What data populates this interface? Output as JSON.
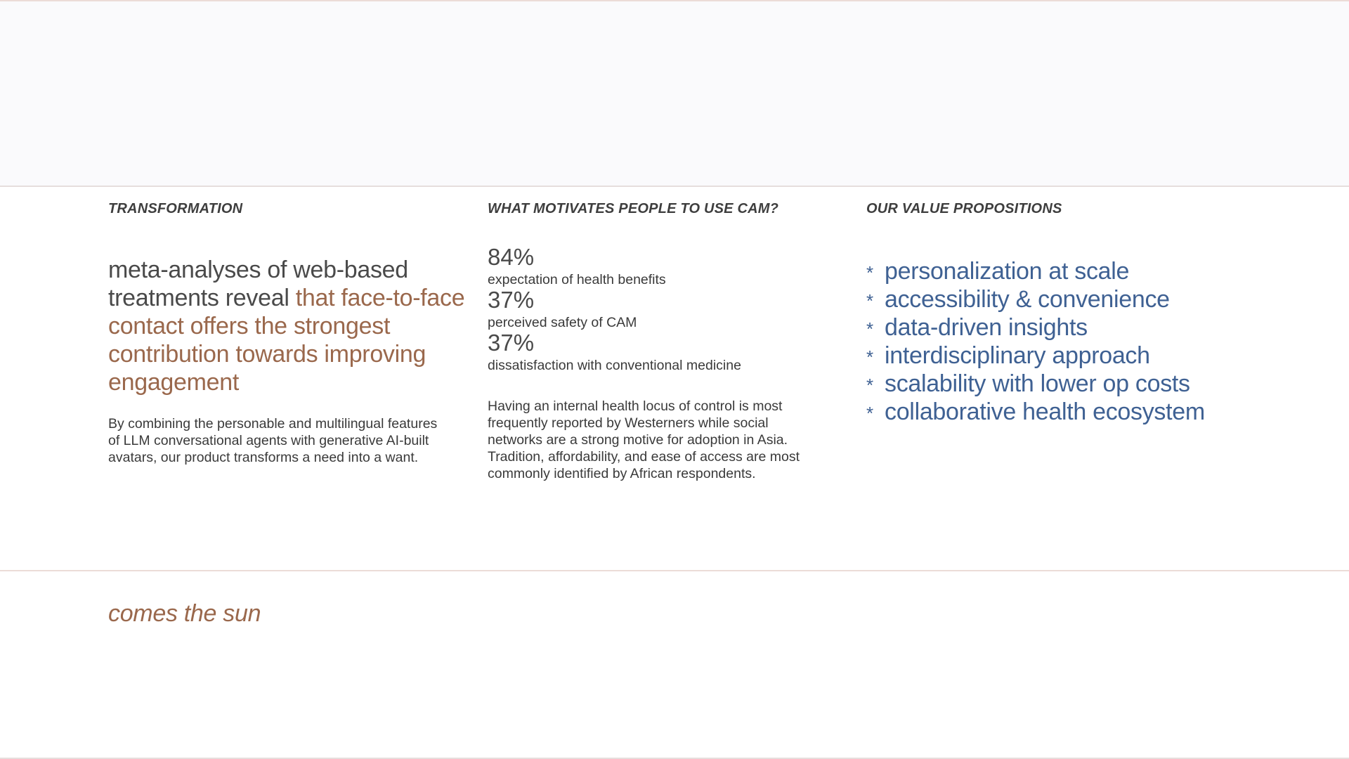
{
  "colors": {
    "accent_brown": "#9a684c",
    "accent_blue": "#3f6193",
    "text_dark": "#4a4a4a",
    "hero_bg": "#fafafc",
    "divider": "#ecdcd7"
  },
  "transformation": {
    "heading": "TRANSFORMATION",
    "lead_plain": "meta-analyses of web-based treatments reveal ",
    "lead_accent": "that face-to-face contact offers the strongest contribution towards improving engagement",
    "body": "By combining the personable and multilingual features of LLM conversational agents with generative AI-built avatars, our product transforms a need into a want."
  },
  "motivations": {
    "heading": "WHAT MOTIVATES PEOPLE TO USE CAM?",
    "stats": [
      {
        "value": "84%",
        "label": "expectation of health benefits"
      },
      {
        "value": "37%",
        "label": "perceived safety of CAM"
      },
      {
        "value": "37%",
        "label": "dissatisfaction with conventional medicine"
      }
    ],
    "body": "Having an internal health locus of control is most frequently reported by Westerners while social networks are a strong motive for adoption in Asia. Tradition, affordability, and ease of access are most commonly identified by African respondents."
  },
  "value_props": {
    "heading": "OUR VALUE PROPOSITIONS",
    "bullet_icon": "asterisk-icon",
    "bullet_glyph": "*",
    "items": [
      "personalization at scale",
      "accessibility & convenience",
      "data-driven insights",
      "interdisciplinary approach",
      "scalability with lower op costs",
      "collaborative health ecosystem"
    ]
  },
  "footer": {
    "text": "comes the sun"
  }
}
